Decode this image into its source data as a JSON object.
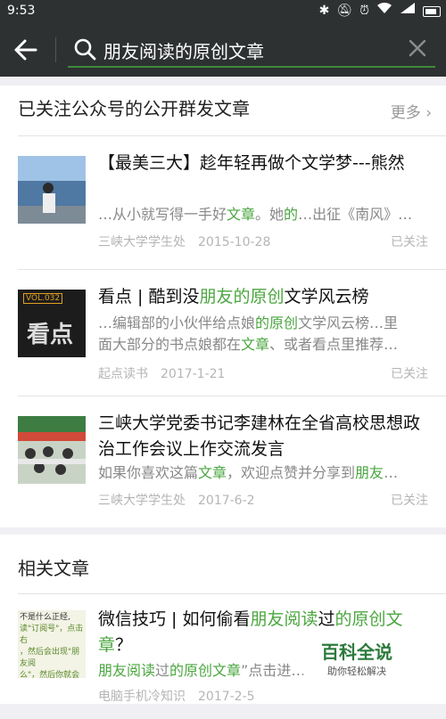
{
  "status": {
    "time": "9:53",
    "icons": [
      "bluetooth-icon",
      "mute-icon",
      "alarm-icon",
      "wifi-icon",
      "signal-icon",
      "battery-icon"
    ]
  },
  "search": {
    "query": "朋友阅读的原创文章"
  },
  "section_followed": {
    "header": "已关注公众号的公开群发文章",
    "more": "更多"
  },
  "articles": [
    {
      "title": "【最美三大】趁年轻再做个文学梦---熊然",
      "snippet": [
        "…从小就写得一手好",
        "文章",
        "。她",
        "的",
        "…出征《南风》…"
      ],
      "source": "三峡大学学生处",
      "date": "2015-10-28",
      "status": "已关注",
      "thumb_colors": [
        "#7fa9cf",
        "#4f78a2"
      ]
    },
    {
      "title_parts": [
        "看点 | 酷到没",
        "朋友的原创",
        "文学风云榜"
      ],
      "snippet_lines": [
        [
          "…编辑部的小伙伴给点娘",
          "的原创",
          "文学风云榜…里"
        ],
        [
          "面大部分的书点娘都在",
          "文章",
          "、或者看点里推荐…"
        ]
      ],
      "source": "起点读书",
      "date": "2017-1-21",
      "status": "已关注",
      "thumb_label_top": "VOL.032",
      "thumb_label": "看点"
    },
    {
      "title": "三峡大学党委书记李建林在全省高校思想政治工作会议上作交流发言",
      "snippet": [
        "如果你喜欢这篇",
        "文章",
        "，欢迎点赞并分享到",
        "朋友",
        "…"
      ],
      "source": "三峡大学学生处",
      "date": "2017-6-2",
      "status": "已关注"
    }
  ],
  "section_related": {
    "header": "相关文章"
  },
  "related": [
    {
      "title_parts": [
        "微信技巧 | 如何偷看",
        "朋友阅读",
        "过",
        "的原创",
        "文章",
        "？"
      ],
      "snippet_parts": [
        "朋友阅读",
        "过",
        "的原创文章",
        "”点击进…"
      ],
      "source": "电脑手机冷知识",
      "date": "2017-2-5",
      "thumb_lines": [
        "不是什么正经,",
        "读\"订阅号\"，点击右",
        "，然后会出现\"朋友阅",
        "么\"，然后你就会发"
      ]
    }
  ],
  "watermark": {
    "line1": "百科全说",
    "line2": "助你轻松解决"
  },
  "colors": {
    "highlight": "#4aa63f",
    "bar": "#2e3132"
  }
}
